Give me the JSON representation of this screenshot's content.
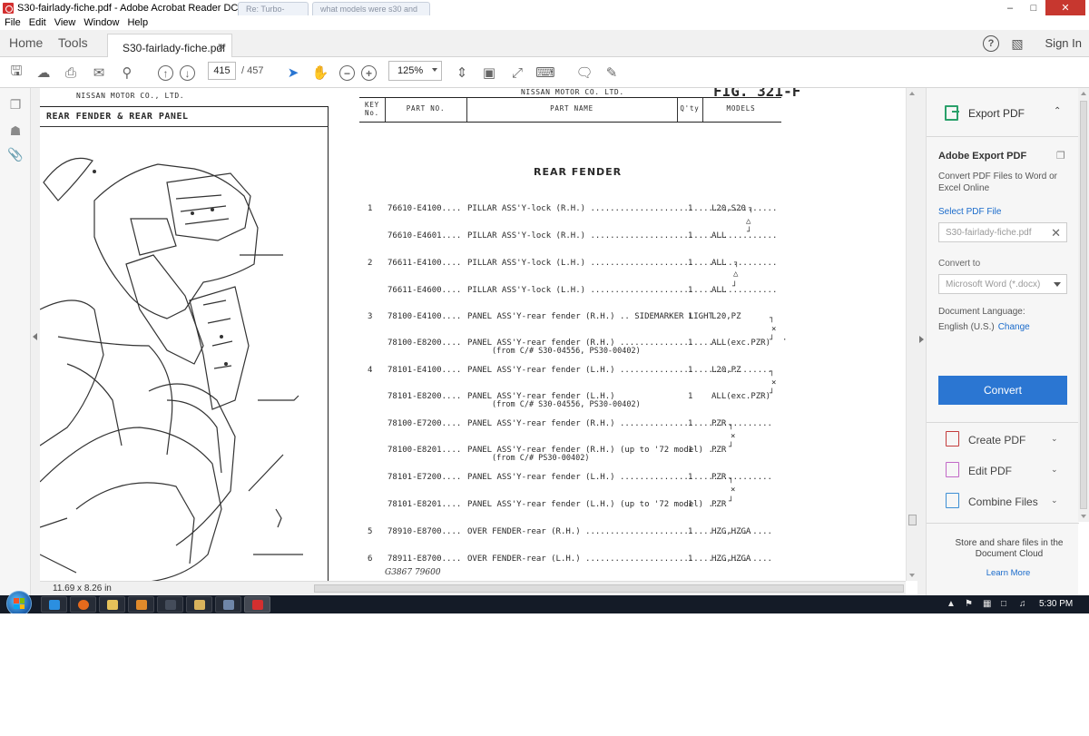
{
  "window": {
    "title": "S30-fairlady-fiche.pdf - Adobe Acrobat Reader DC",
    "ghost_tabs": [
      "Re: Turbo-",
      "what models were s30 and"
    ]
  },
  "menu": [
    "File",
    "Edit",
    "View",
    "Window",
    "Help"
  ],
  "tabs": {
    "home": "Home",
    "tools": "Tools",
    "document": "S30-fairlady-fiche.pdf",
    "sign_in": "Sign In"
  },
  "toolbar": {
    "page_current": "415",
    "page_total": "/ 457",
    "zoom": "125%"
  },
  "status": {
    "page_size": "11.69 x 8.26 in"
  },
  "document": {
    "header_left": "NISSAN MOTOR CO., LTD.",
    "header_right": "NISSAN MOTOR CO. LTD.",
    "fig": "FIG. 321-F",
    "section_title": "REAR  FENDER  &  REAR  PANEL",
    "columns": {
      "key": "KEY No.",
      "part_no": "PART NO.",
      "part_name": "PART NAME",
      "qty": "Q'ty",
      "models": "MODELS"
    },
    "heading": "REAR FENDER",
    "rows": [
      {
        "key": "1",
        "part_no": "76610-E4100....",
        "name": "PILLAR ASS'Y-lock (R.H.) ......................................",
        "qty": "1",
        "models": "L20,S20",
        "sub": ""
      },
      {
        "key": "",
        "part_no": "76610-E4601....",
        "name": "PILLAR ASS'Y-lock (R.H.) ......................................",
        "qty": "1",
        "models": "ALL",
        "sub": ""
      },
      {
        "key": "2",
        "part_no": "76611-E4100....",
        "name": "PILLAR ASS'Y-lock (L.H.) ......................................",
        "qty": "1",
        "models": "ALL",
        "sub": ""
      },
      {
        "key": "",
        "part_no": "76611-E4600....",
        "name": "PILLAR ASS'Y-lock (L.H.) ......................................",
        "qty": "1",
        "models": "ALL",
        "sub": ""
      },
      {
        "key": "3",
        "part_no": "78100-E4100....",
        "name": "PANEL ASS'Y-rear fender (R.H.) .. SIDEMARKER LIGHT",
        "qty": "1",
        "models": "L20,PZ",
        "sub": ""
      },
      {
        "key": "",
        "part_no": "78100-E8200....",
        "name": "PANEL ASS'Y-rear fender (R.H.)  .....................",
        "qty": "1",
        "models": "ALL(exc.PZR)",
        "sub": "(from C/# S30-04556, PS30-00402)"
      },
      {
        "key": "4",
        "part_no": "78101-E4100....",
        "name": "PANEL ASS'Y-rear fender (L.H.) ...............................",
        "qty": "1",
        "models": "L20,PZ",
        "sub": ""
      },
      {
        "key": "",
        "part_no": "78101-E8200....",
        "name": "PANEL ASS'Y-rear fender (L.H.)",
        "qty": "1",
        "models": "ALL(exc.PZR)",
        "sub": "(from C/# S30-04556, PS30-00402)"
      },
      {
        "key": "",
        "part_no": "78100-E7200....",
        "name": "PANEL ASS'Y-rear fender (R.H.) ...............................",
        "qty": "1",
        "models": "PZR",
        "sub": ""
      },
      {
        "key": "",
        "part_no": "78100-E8201....",
        "name": "PANEL ASS'Y-rear fender (R.H.) (up to '72 model) ..",
        "qty": "1",
        "models": "PZR",
        "sub": "(from C/# PS30-00402)"
      },
      {
        "key": "",
        "part_no": "78101-E7200....",
        "name": "PANEL ASS'Y-rear fender (L.H.) ...............................",
        "qty": "1",
        "models": "PZR",
        "sub": ""
      },
      {
        "key": "",
        "part_no": "78101-E8201....",
        "name": "PANEL ASS'Y-rear fender (L.H.) (up to '72 model) ..",
        "qty": "1",
        "models": "PZR",
        "sub": ""
      },
      {
        "key": "5",
        "part_no": "78910-E8700....",
        "name": "OVER FENDER-rear (R.H.) ......................................",
        "qty": "1",
        "models": "HZG,HZGA",
        "sub": ""
      },
      {
        "key": "6",
        "part_no": "78911-E8700....",
        "name": "OVER FENDER-rear (L.H.) ......................................",
        "qty": "1",
        "models": "HZG,HZGA",
        "sub": ""
      }
    ],
    "handwritten": "G3867  79600"
  },
  "right_pane": {
    "export_header": "Export PDF",
    "title": "Adobe Export PDF",
    "description": "Convert PDF Files to Word or Excel Online",
    "select_link": "Select PDF File",
    "file_name": "S30-fairlady-fiche.pdf",
    "convert_to_label": "Convert to",
    "convert_to_value": "Microsoft Word (*.docx)",
    "language_label": "Document Language:",
    "language_value": "English (U.S.)",
    "language_change": "Change",
    "convert_button": "Convert",
    "tools": [
      {
        "label": "Create PDF"
      },
      {
        "label": "Edit PDF"
      },
      {
        "label": "Combine Files"
      }
    ],
    "store_text": "Store and share files in the Document Cloud",
    "learn_more": "Learn More"
  },
  "taskbar": {
    "clock": "5:30 PM"
  },
  "colors": {
    "accent": "#2b76d2",
    "export_icon": "#2aa06a",
    "taskbar": "#141b27",
    "close_button": "#c7372f"
  }
}
